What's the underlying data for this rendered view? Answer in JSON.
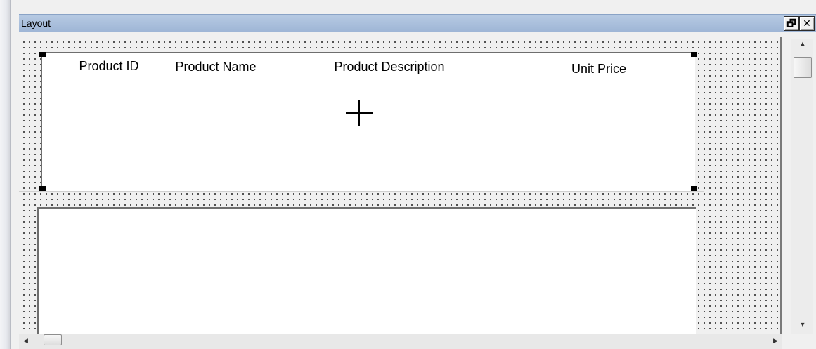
{
  "window": {
    "title": "Layout",
    "restore_label": "🗗",
    "close_label": "✕"
  },
  "layout": {
    "columns": [
      {
        "label": "Product ID"
      },
      {
        "label": "Product Name"
      },
      {
        "label": "Product Description"
      },
      {
        "label": "Unit Price"
      }
    ]
  },
  "scrollbars": {
    "up_arrow": "▲",
    "down_arrow": "▼",
    "left_arrow": "◀",
    "right_arrow": "▶"
  },
  "icons": {
    "cursor": "crosshair-icon"
  },
  "colors": {
    "title_bar": "#a9bfdc",
    "canvas": "#f0f0f0",
    "band": "#ffffff",
    "dots": "#3a3a3a"
  }
}
